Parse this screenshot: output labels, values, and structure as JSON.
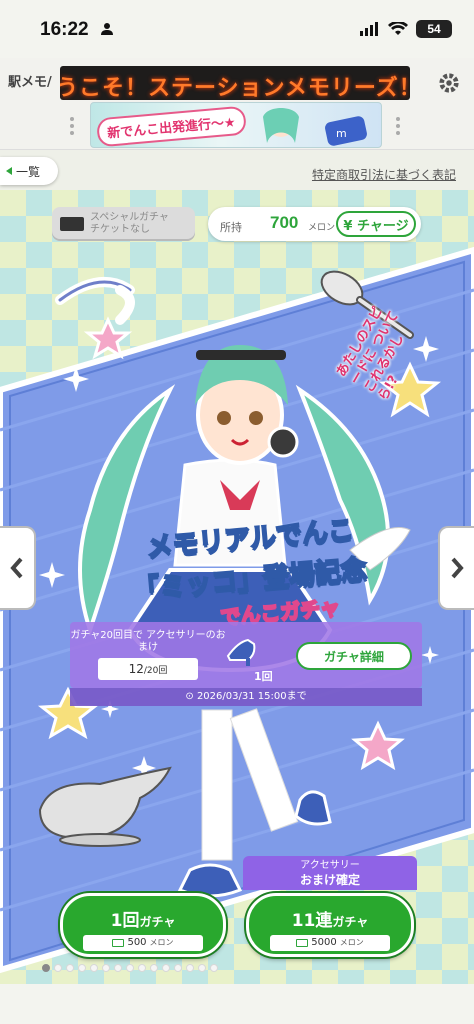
{
  "status_bar": {
    "time": "16:22",
    "battery": "54"
  },
  "header": {
    "logo": "駅メモ/",
    "ticker": "うこそ！ステーションメモリーズ！に",
    "banner_text": "新でんこ出発進行〜★"
  },
  "subbar": {
    "back_label": "一覧",
    "legal_link": "特定商取引法に基づく表記"
  },
  "wallet": {
    "ticket_text_1": "スペシャルガチャ",
    "ticket_text_2": "チケットなし",
    "label": "所持",
    "amount": "700",
    "unit": "メロン",
    "charge_label": "¥ チャージ"
  },
  "gacha": {
    "speech": "あたしのスピードに ついてこれるかしら!?",
    "title_line1": "メモリアルでんこ",
    "title_line2": "「ミッコ」登場記念",
    "title_line3": "でんこガチャ",
    "bonus_label": "ガチャ20回目で アクセサリーのおまけ",
    "bonus_progress_current": "12",
    "bonus_progress_total": "/20回",
    "bonus_qty": "1回",
    "details_label": "ガチャ詳細",
    "deadline": "⊙ 2026/03/31 15:00まで",
    "accessory_line1": "アクセサリー",
    "accessory_line2": "おまけ確定"
  },
  "pulls": {
    "single_count": "1回",
    "single_suffix": "ガチャ",
    "single_price": "500",
    "multi_count": "11連",
    "multi_suffix": "ガチャ",
    "multi_price": "5000",
    "currency": "メロン"
  },
  "pager": {
    "total": 15,
    "active": 0
  },
  "colors": {
    "accent": "#2ea53b",
    "ticker": "#ff7a2a",
    "bonus_panel": "#a078e6"
  }
}
